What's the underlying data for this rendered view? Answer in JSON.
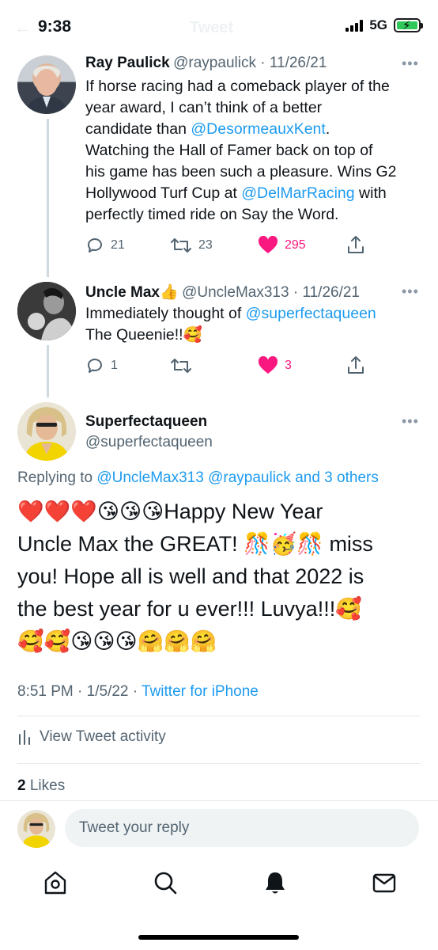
{
  "status_bar": {
    "time": "9:38",
    "network": "5G",
    "battery_level": 1.0,
    "battery_charging": true
  },
  "header": {
    "title": "Tweet"
  },
  "tweet1": {
    "name": "Ray Paulick",
    "handle": "@raypaulick",
    "date": "11/26/21",
    "text_line1": "If horse racing had a comeback player of the",
    "text_line2": "year award, I can’t think of a better",
    "text_line3_pre": "candidate than ",
    "mention1": "@DesormeauxKent",
    "text_line3_post": ".",
    "text_line4": "Watching the Hall of Famer back on top of",
    "text_line5": "his game has been such a pleasure. Wins G2",
    "text_line6_pre": "Hollywood Turf Cup at ",
    "mention2": "@DelMarRacing",
    "text_line6_post": " with",
    "text_line7": "perfectly timed ride on Say the Word.",
    "replies": "21",
    "retweets": "23",
    "likes": "295"
  },
  "tweet2": {
    "name": "Uncle Max👍",
    "handle": "@UncleMax313",
    "date": "11/26/21",
    "text_pre": "Immediately thought of ",
    "mention": "@superfectaqueen",
    "text_line2": "The Queenie!!🥰",
    "replies": "1",
    "likes": "3"
  },
  "main_tweet": {
    "name": "Superfectaqueen",
    "handle": "@superfectaqueen",
    "replying_label": "Replying to ",
    "replying_to1": "@UncleMax313",
    "replying_to2": "@raypaulick",
    "replying_more": "and 3 others",
    "line1": "❤️❤️❤️😘😘😘Happy New Year",
    "line2": "Uncle Max the GREAT! 🎊🥳🎊 miss",
    "line3": "you! Hope all is well and that 2022 is",
    "line4": "the best year for u ever!!! Luvya!!!🥰",
    "line5": "🥰🥰😘😘😘🤗🤗🤗",
    "time": "8:51 PM",
    "date": "1/5/22",
    "source": "Twitter for iPhone",
    "activity_label": "View Tweet activity",
    "likes_count": "2",
    "likes_label": "Likes"
  },
  "reply_bar": {
    "placeholder": "Tweet your reply"
  },
  "bottom_nav": {
    "items": [
      "home-icon",
      "search-icon",
      "notifications-icon",
      "messages-icon"
    ]
  },
  "colors": {
    "accent": "#1d9bf0",
    "like": "#f91880",
    "text": "#0f1419",
    "secondary": "#536471"
  }
}
